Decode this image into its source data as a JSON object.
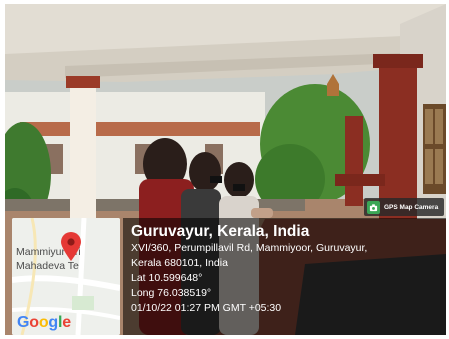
{
  "badge": {
    "label": "GPS Map Camera",
    "icon": "gps-camera-icon"
  },
  "map": {
    "label_line1": "Mammiyur Sri",
    "label_line2": "Mahadeva Te",
    "pin_icon": "map-pin-icon",
    "logo": "Google",
    "logo_colors": [
      "#4285F4",
      "#EA4335",
      "#FBBC05",
      "#4285F4",
      "#34A853",
      "#EA4335"
    ]
  },
  "location": {
    "title": "Guruvayur, Kerala, India",
    "address_line1": "XVI/360, Perumpillavil Rd, Mammiyoor, Guruvayur,",
    "address_line2": "Kerala 680101, India",
    "latitude": "Lat 10.599648°",
    "longitude": "Long 76.038519°",
    "datetime": "01/10/22 01:27 PM GMT +05:30"
  }
}
